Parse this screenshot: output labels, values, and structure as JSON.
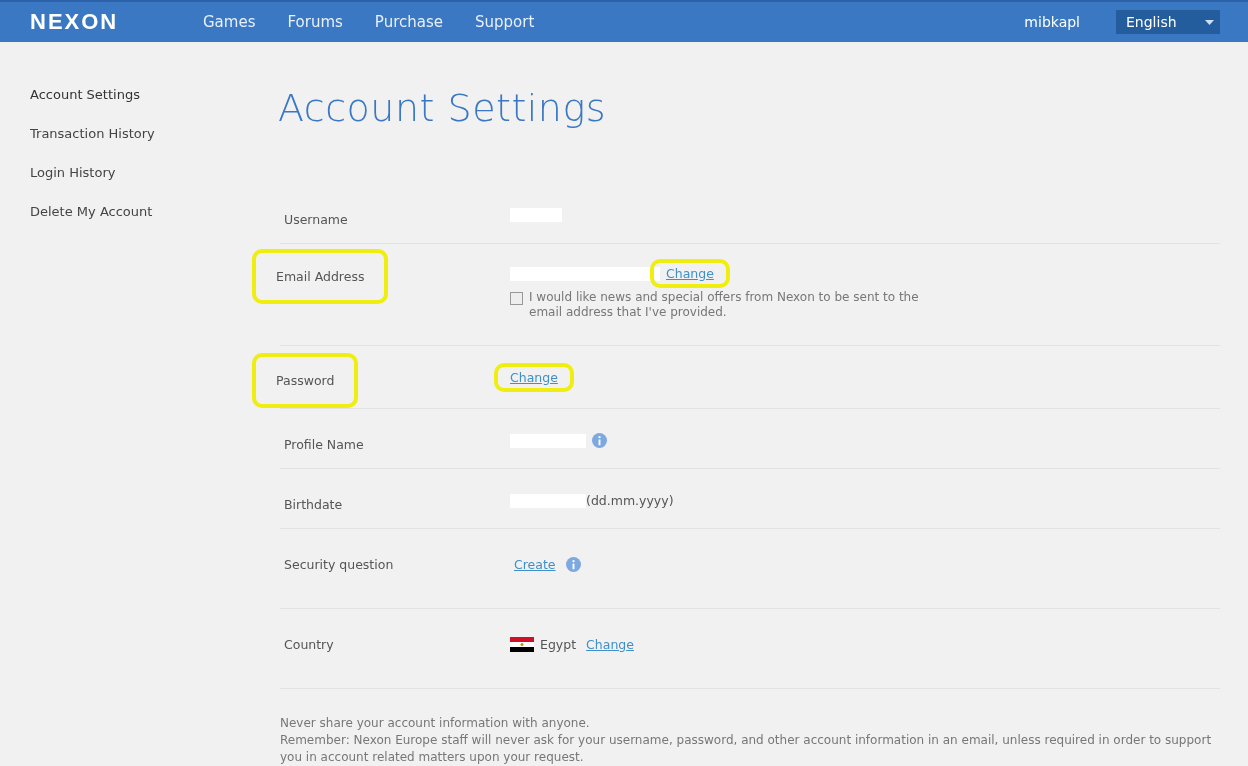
{
  "nav": {
    "logo": "NEXON",
    "links": [
      "Games",
      "Forums",
      "Purchase",
      "Support"
    ],
    "user": "mibkapl",
    "language": "English"
  },
  "sidebar": {
    "items": [
      {
        "label": "Account Settings",
        "selected": true
      },
      {
        "label": "Transaction History",
        "selected": false
      },
      {
        "label": "Login History",
        "selected": false
      },
      {
        "label": "Delete My Account",
        "selected": false
      }
    ]
  },
  "title": "Account Settings",
  "rows": [
    {
      "kind": "redacted",
      "label": "Username",
      "highlighted": false
    },
    {
      "kind": "email",
      "label": "Email Address",
      "highlighted": true,
      "link": {
        "text": "Change",
        "highlighted": true
      },
      "consent": {
        "text": "I would like news and special offers from Nexon to be sent to the email address that I've provided.",
        "checked": false
      }
    },
    {
      "kind": "link",
      "label": "Password",
      "highlighted": true,
      "link": {
        "text": "Change",
        "highlighted": true
      }
    },
    {
      "kind": "info",
      "label": "Profile Name",
      "highlighted": false
    },
    {
      "kind": "date",
      "label": "Birthdate",
      "highlighted": false,
      "hint": "(dd.mm.yyyy)"
    },
    {
      "kind": "link_info",
      "label": "Security question",
      "highlighted": false,
      "link": {
        "text": "Create",
        "highlighted": false
      }
    },
    {
      "kind": "country",
      "label": "Country",
      "highlighted": false,
      "country": "Egypt",
      "link": {
        "text": "Change",
        "highlighted": false
      }
    }
  ],
  "footer": [
    "Never share your account information with anyone.",
    "Remember: Nexon Europe staff will never ask for your username, password, and other account information in an email, unless required in order to support you in account related matters upon your request."
  ]
}
